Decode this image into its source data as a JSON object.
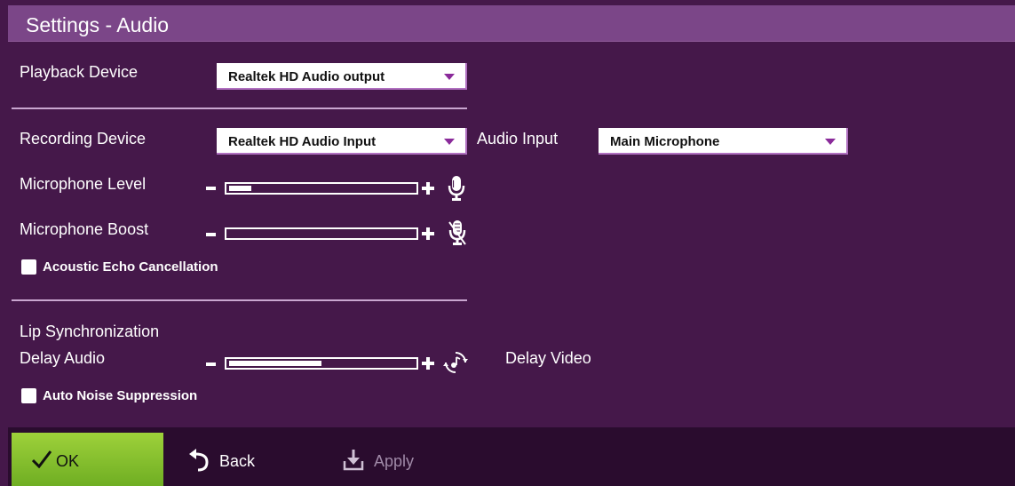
{
  "title": "Settings - Audio",
  "playback": {
    "label": "Playback Device",
    "selected": "Realtek HD Audio output"
  },
  "recording": {
    "label": "Recording Device",
    "selected": "Realtek HD Audio Input",
    "audio_input_label": "Audio Input",
    "audio_input_selected": "Main Microphone"
  },
  "mic_level": {
    "label": "Microphone Level",
    "value_fraction": 0.12
  },
  "mic_boost": {
    "label": "Microphone Boost",
    "value_fraction": 0.0
  },
  "echo_cancel": {
    "label": "Acoustic Echo Cancellation",
    "checked": false
  },
  "lip_sync": {
    "heading": "Lip Synchronization",
    "left_label": "Delay Audio",
    "right_label": "Delay Video",
    "value_fraction": 0.5
  },
  "noise_suppression": {
    "label": "Auto Noise Suppression",
    "checked": false
  },
  "footer": {
    "ok_label": "OK",
    "back_label": "Back",
    "apply_label": "Apply"
  },
  "colors": {
    "background": "#45184a",
    "titlebar": "#7b4688",
    "ok_button": "#8cc63f",
    "footer": "#2a0c2e",
    "apply_disabled": "#a08aa8"
  }
}
